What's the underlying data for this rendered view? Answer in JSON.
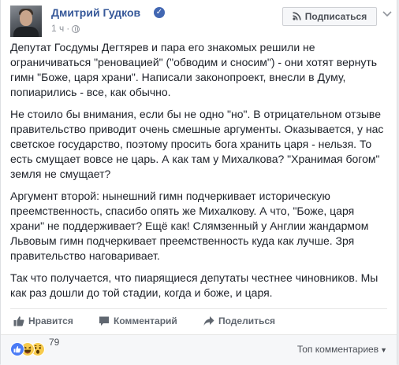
{
  "post": {
    "author": "Дмитрий Гудков",
    "time": "1 ч",
    "dot": "·",
    "subscribe_label": "Подписаться",
    "paragraphs": [
      "Депутат Госдумы Дегтярев и пара его знакомых решили не\nограничиваться \"реновацией\" (\"обводим и сносим\") - они хотят вернуть\nгимн \"Боже, царя храни\". Написали законопроект, внесли в Думу,\nпопиарились - все, как обычно.",
      "Не стоило бы внимания, если бы не одно \"но\". В отрицательном отзыве\nправительство приводит очень смешные аргументы. Оказывается, у нас\nсветское государство, поэтому просить бога хранить царя - нельзя. То\nесть смущает вовсе не царь. А как там у Михалкова? \"Хранимая богом\"\nземля не смущает?",
      "Аргумент второй: нынешний гимн подчеркивает историческую\nпреемственность, спасибо опять же Михалкову. А что, \"Боже, царя\nхрани\" не поддерживает? Ещё как! Слямзенный у Англии жандармом\nЛьвовым гимн подчеркивает преемственность куда как лучше. Зря\nправительство наговаривает.",
      "Так что получается, что пиарящиеся депутаты честнее чиновников. Мы\nкак раз дошли до той стадии, когда и боже, и царя."
    ]
  },
  "actions": {
    "like": "Нравится",
    "comment": "Комментарий",
    "share": "Поделиться"
  },
  "footer": {
    "reaction_count": "79",
    "sort_label": "Топ комментариев",
    "caret": "▼"
  },
  "colors": {
    "link": "#365899",
    "text": "#1d2129",
    "muted": "#90949c",
    "like_blue": "#4a7bf6",
    "emoji_yellow": "#f7cb4d"
  },
  "icons": [
    "verified-badge-icon",
    "globe-icon",
    "rss-icon",
    "chevron-down-icon",
    "like-thumb-icon",
    "comment-bubble-icon",
    "share-arrow-icon",
    "like-reaction-icon",
    "haha-reaction-icon",
    "wow-reaction-icon"
  ]
}
